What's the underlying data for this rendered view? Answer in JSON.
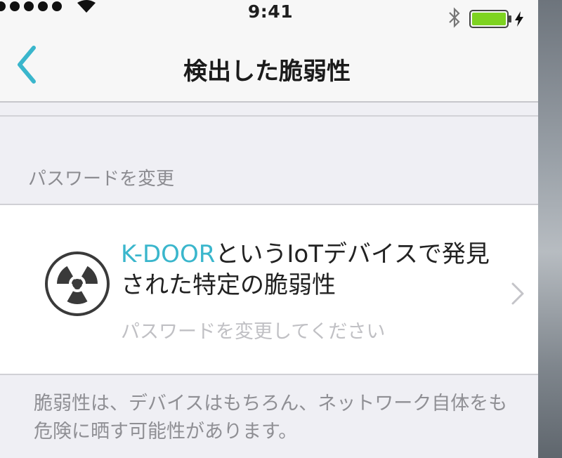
{
  "status_bar": {
    "time": "9:41"
  },
  "nav": {
    "title": "検出した脆弱性",
    "back_icon": "chevron-left-icon"
  },
  "section": {
    "header": "パスワードを変更"
  },
  "vulnerability": {
    "icon": "radiation-icon",
    "title_brand": "K-DOOR",
    "title_rest": "というIoTデバイスで発見された特定の脆弱性",
    "subtitle": "パスワードを変更してください"
  },
  "footer": {
    "note": "脆弱性は、デバイスはもちろん、ネットワーク自体をも危険に晒す可能性があります。"
  },
  "colors": {
    "accent": "#3ab6cc",
    "battery": "#7ed321"
  }
}
